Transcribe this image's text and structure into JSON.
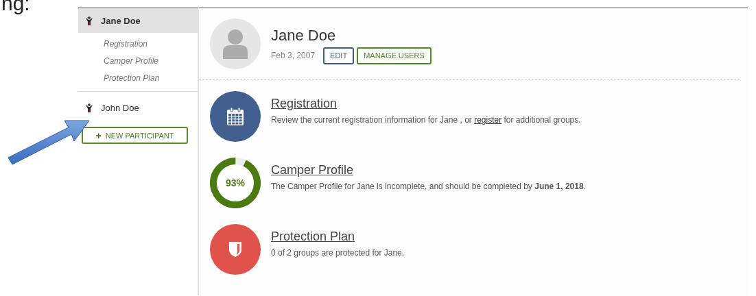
{
  "page_fragment": "ng:",
  "sidebar": {
    "participants": [
      {
        "name": "Jane Doe",
        "selected": true,
        "expanded": true,
        "children": [
          {
            "label": "Registration"
          },
          {
            "label": "Camper Profile"
          },
          {
            "label": "Protection Plan"
          }
        ]
      },
      {
        "name": "John Doe",
        "selected": false,
        "expanded": false
      }
    ],
    "new_button": {
      "icon": "+",
      "label": "NEW PARTICIPANT"
    }
  },
  "profile": {
    "name": "Jane Doe",
    "date": "Feb 3, 2007",
    "buttons": [
      {
        "label": "EDIT",
        "color": "#3f5f8f"
      },
      {
        "label": "MANAGE USERS",
        "color": "#4e8a1c"
      }
    ]
  },
  "sections": [
    {
      "kind": "calendar",
      "color": "#42608f",
      "title": "Registration",
      "description": [
        {
          "kind": "text",
          "text": "Review the current registration information for Jane , or "
        },
        {
          "kind": "link",
          "text": "register"
        },
        {
          "kind": "text",
          "text": " for additional groups."
        }
      ]
    },
    {
      "kind": "progress",
      "color": "#4b7a10",
      "level": 0.93,
      "reading": "93%",
      "title": "Camper Profile",
      "description": [
        {
          "kind": "text",
          "text": "The Camper Profile for Jane is incomplete, and should be completed by **June 1, 2018**."
        }
      ]
    },
    {
      "kind": "shield",
      "color": "#e0534a",
      "title": "Protection Plan",
      "description": [
        {
          "kind": "text",
          "text": "0 of 2 groups are protected for Jane."
        }
      ]
    }
  ]
}
